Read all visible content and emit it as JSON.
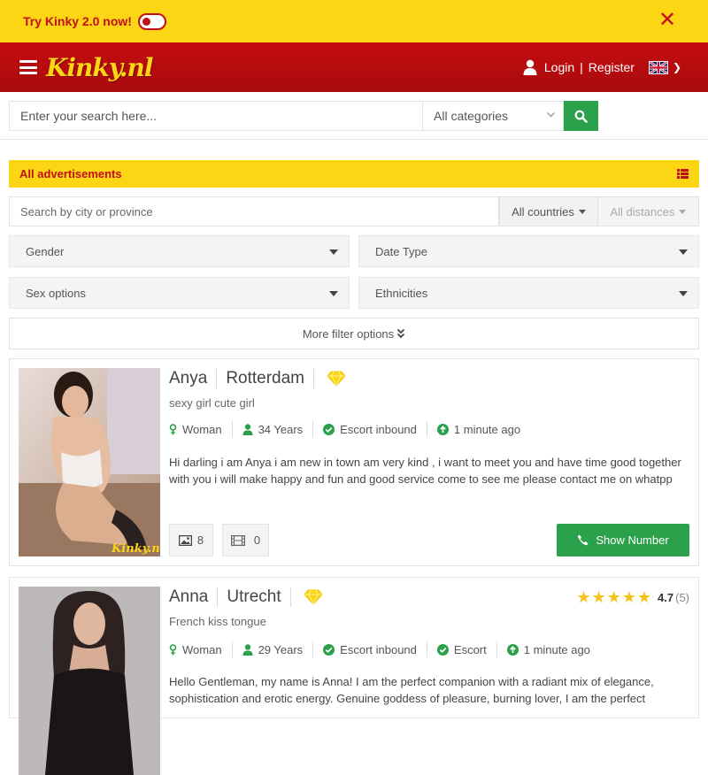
{
  "promo": {
    "text": "Try Kinky 2.0 now!",
    "close_icon": "close-icon"
  },
  "header": {
    "logo": "Kinky.nl",
    "login": "Login",
    "separator": "|",
    "register": "Register",
    "language": "english-flag"
  },
  "search": {
    "placeholder": "Enter your search here...",
    "category": "All categories"
  },
  "ads_bar": {
    "title": "All advertisements"
  },
  "filters": {
    "city_placeholder": "Search by city or province",
    "countries": "All countries",
    "distances": "All distances",
    "gender": "Gender",
    "date_type": "Date Type",
    "sex_options": "Sex options",
    "ethnicities": "Ethnicities",
    "more": "More filter options"
  },
  "colors": {
    "brand_yellow": "#fcd514",
    "brand_red": "#c0101a",
    "action_green": "#2aa14a"
  },
  "ads": [
    {
      "name": "Anya",
      "city": "Rotterdam",
      "tagline": "sexy girl cute girl",
      "gender": "Woman",
      "age": "34 Years",
      "type": "Escort inbound",
      "posted": "1 minute ago",
      "description": "Hi darling i am Anya i am new in town am very kind , i want to meet you and have time good together with you i will make happy and fun and good service come to see me please contact me on whatpp",
      "photos": "8",
      "videos": "0",
      "show_number": "Show Number",
      "watermark": "Kinky.nl"
    },
    {
      "name": "Anna",
      "city": "Utrecht",
      "tagline": "French kiss tongue",
      "gender": "Woman",
      "age": "29 Years",
      "type": "Escort inbound",
      "type2": "Escort",
      "posted": "1 minute ago",
      "rating": "4.7",
      "rating_count": "(5)",
      "rating_stars": 4.7,
      "description": "Hello Gentleman, my name is Anna! I am the perfect companion with a radiant mix of elegance, sophistication and erotic energy. Genuine goddess of pleasure, burning lover, I am the perfect"
    }
  ]
}
